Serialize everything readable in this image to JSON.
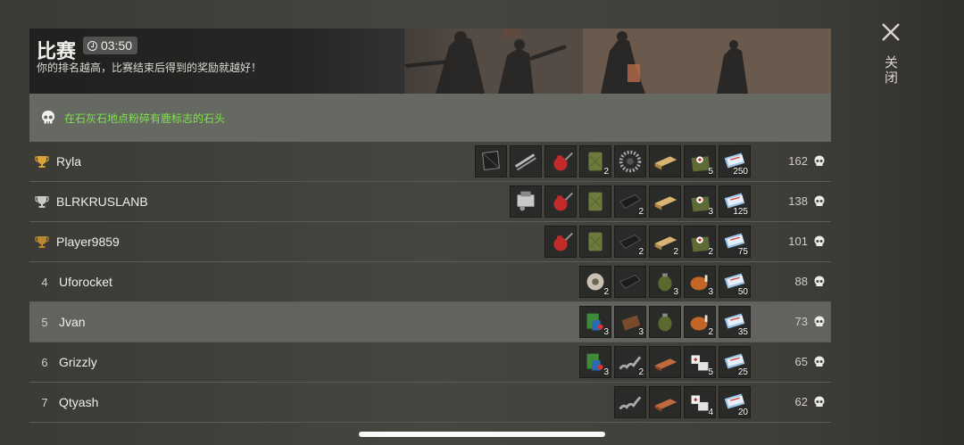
{
  "header": {
    "title": "比赛",
    "timer": "03:50",
    "subtitle": "你的排名越高，比赛结束后得到的奖励就越好！"
  },
  "quest": {
    "text": "在石灰石地点粉碎有鹿标志的石头"
  },
  "close": {
    "label": "关闭"
  },
  "colors": {
    "quest_text": "#7ee34a",
    "gold": "#d9a53a",
    "silver": "#c9c9c9",
    "bronze": "#b9892f"
  },
  "rows": [
    {
      "rank": "",
      "trophy": "gold",
      "name": "Ryla",
      "score": "162",
      "highlight": false,
      "items": [
        {
          "icon": "tarp-icon",
          "count": ""
        },
        {
          "icon": "pipes-icon",
          "count": ""
        },
        {
          "icon": "oil-can-icon",
          "count": ""
        },
        {
          "icon": "jerrycan-icon",
          "count": "2"
        },
        {
          "icon": "gear-icon",
          "count": ""
        },
        {
          "icon": "plank-icon",
          "count": ""
        },
        {
          "icon": "medkit-bag-icon",
          "count": "5"
        },
        {
          "icon": "ticket-icon",
          "count": "250"
        }
      ]
    },
    {
      "rank": "",
      "trophy": "silver",
      "name": "BLRKRUSLANB",
      "score": "138",
      "highlight": false,
      "items": [
        {
          "icon": "engine-icon",
          "count": ""
        },
        {
          "icon": "oil-can-icon",
          "count": ""
        },
        {
          "icon": "jerrycan-icon",
          "count": ""
        },
        {
          "icon": "cloth-icon",
          "count": "2"
        },
        {
          "icon": "plank-icon",
          "count": ""
        },
        {
          "icon": "medkit-bag-icon",
          "count": "3"
        },
        {
          "icon": "ticket-icon",
          "count": "125"
        }
      ]
    },
    {
      "rank": "",
      "trophy": "bronze",
      "name": "Player9859",
      "score": "101",
      "highlight": false,
      "items": [
        {
          "icon": "oil-can-icon",
          "count": ""
        },
        {
          "icon": "jerrycan-icon",
          "count": ""
        },
        {
          "icon": "cloth-icon",
          "count": "2"
        },
        {
          "icon": "plank-icon",
          "count": "2"
        },
        {
          "icon": "medkit-bag-icon",
          "count": "2"
        },
        {
          "icon": "ticket-icon",
          "count": "75"
        }
      ]
    },
    {
      "rank": "4",
      "trophy": "",
      "name": "Uforocket",
      "score": "88",
      "highlight": false,
      "items": [
        {
          "icon": "wire-spool-icon",
          "count": "2"
        },
        {
          "icon": "cloth-icon",
          "count": ""
        },
        {
          "icon": "grenade-icon",
          "count": "3"
        },
        {
          "icon": "roast-chicken-icon",
          "count": "3"
        },
        {
          "icon": "ticket-icon",
          "count": "50"
        }
      ]
    },
    {
      "rank": "5",
      "trophy": "",
      "name": "Jvan",
      "score": "73",
      "highlight": true,
      "items": [
        {
          "icon": "dice-book-icon",
          "count": "3"
        },
        {
          "icon": "leather-icon",
          "count": "3"
        },
        {
          "icon": "grenade-icon",
          "count": ""
        },
        {
          "icon": "roast-chicken-icon",
          "count": "2"
        },
        {
          "icon": "ticket-icon",
          "count": "35"
        }
      ]
    },
    {
      "rank": "6",
      "trophy": "",
      "name": "Grizzly",
      "score": "65",
      "highlight": false,
      "items": [
        {
          "icon": "dice-book-icon",
          "count": "3"
        },
        {
          "icon": "spring-icon",
          "count": "2"
        },
        {
          "icon": "copper-ingot-icon",
          "count": ""
        },
        {
          "icon": "bandage-icon",
          "count": "5"
        },
        {
          "icon": "ticket-icon",
          "count": "25"
        }
      ]
    },
    {
      "rank": "7",
      "trophy": "",
      "name": "Qtyash",
      "score": "62",
      "highlight": false,
      "items": [
        {
          "icon": "spring-icon",
          "count": ""
        },
        {
          "icon": "copper-ingot-icon",
          "count": ""
        },
        {
          "icon": "bandage-icon",
          "count": "4"
        },
        {
          "icon": "ticket-icon",
          "count": "20"
        }
      ]
    }
  ]
}
